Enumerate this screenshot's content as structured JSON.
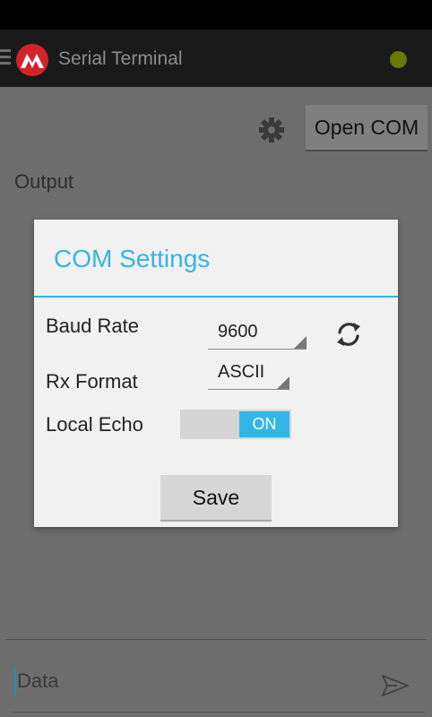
{
  "app": {
    "title": "Serial Terminal"
  },
  "toolbar": {
    "open_com_label": "Open COM"
  },
  "main": {
    "output_label": "Output",
    "data_placeholder": "Data"
  },
  "dialog": {
    "title": "COM Settings",
    "baud_rate": {
      "label": "Baud Rate",
      "value": "9600"
    },
    "rx_format": {
      "label": "Rx Format",
      "value": "ASCII"
    },
    "local_echo": {
      "label": "Local Echo",
      "state": "ON"
    },
    "save_label": "Save"
  },
  "colors": {
    "accent": "#33b5e5",
    "status_dot": "#6a7a00",
    "logo": "#d3232a"
  },
  "icons": [
    "menu-icon",
    "app-logo-icon",
    "status-indicator-icon",
    "gear-icon",
    "refresh-icon",
    "send-icon"
  ]
}
